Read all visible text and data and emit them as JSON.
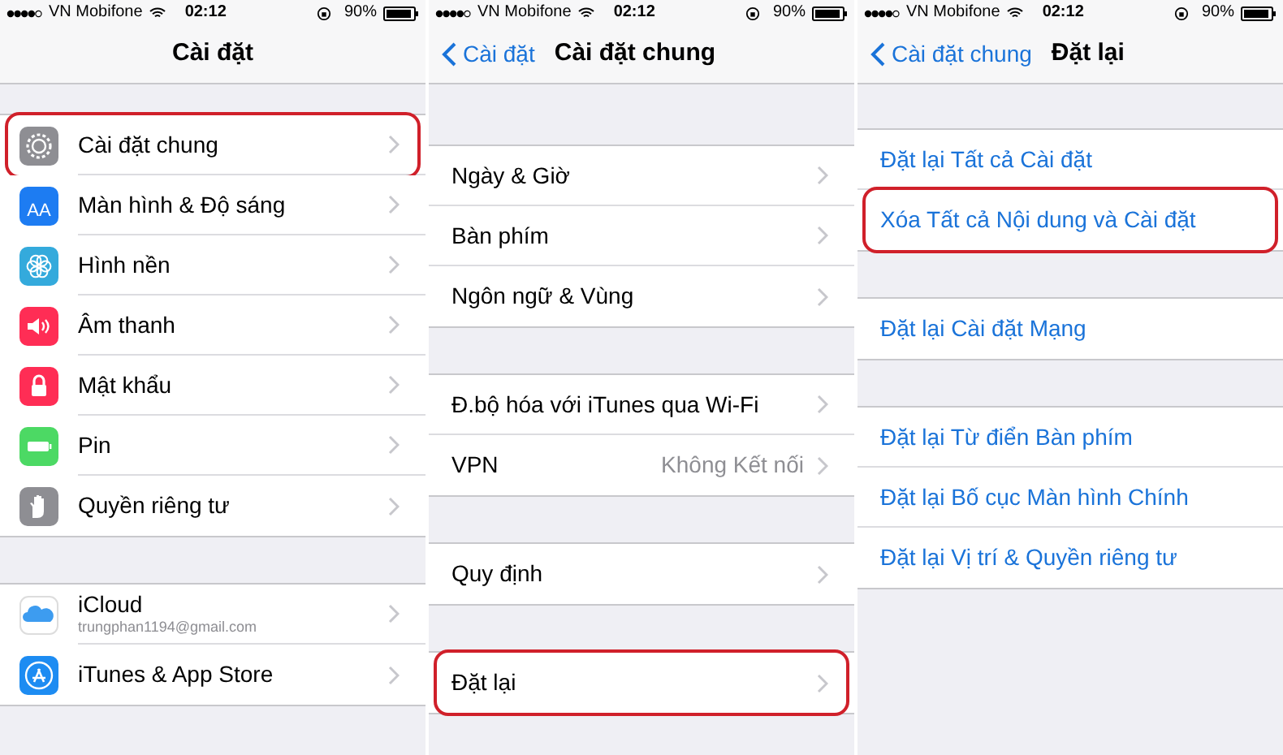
{
  "panels": [
    {
      "status": {
        "carrier": "VN Mobifone",
        "time": "02:12",
        "battery": "90%"
      },
      "nav": {
        "title": "Cài đặt"
      },
      "groups": [
        {
          "rows": [
            {
              "kind": "nav",
              "color": "#8e8e93",
              "label": "Cài đặt chung",
              "highlighted": true
            },
            {
              "kind": "nav",
              "icon_label": "AA",
              "color": "#1d7cf2",
              "label": "Màn hình & Độ sáng",
              "highlighted": false
            },
            {
              "kind": "nav",
              "color": "#34aadc",
              "label": "Hình nền",
              "highlighted": false
            },
            {
              "kind": "nav",
              "color": "#ff2d55",
              "label": "Âm thanh",
              "highlighted": false
            },
            {
              "kind": "nav",
              "color": "#ff2d55",
              "label": "Mật khẩu",
              "highlighted": false
            },
            {
              "kind": "nav",
              "color": "#4cd964",
              "label": "Pin",
              "highlighted": false
            },
            {
              "kind": "nav",
              "color": "#8e8e93",
              "label": "Quyền riêng tư",
              "highlighted": false
            }
          ]
        },
        {
          "rows": [
            {
              "kind": "nav",
              "color": "#3d9cf0",
              "label": "iCloud",
              "subtitle": "trungphan1194@gmail.com",
              "highlighted": false
            },
            {
              "kind": "nav",
              "color": "#1d8cf2",
              "label": "iTunes & App Store",
              "highlighted": false
            }
          ]
        }
      ]
    },
    {
      "status": {
        "carrier": "VN Mobifone",
        "time": "02:12",
        "battery": "90%"
      },
      "nav": {
        "back": "Cài đặt",
        "title": "Cài đặt chung"
      },
      "groups": [
        {
          "rows": [
            {
              "kind": "nav",
              "label": "Ngày & Giờ",
              "highlighted": false
            },
            {
              "kind": "nav",
              "label": "Bàn phím",
              "highlighted": false
            },
            {
              "kind": "nav",
              "label": "Ngôn ngữ & Vùng",
              "highlighted": false
            }
          ]
        },
        {
          "rows": [
            {
              "kind": "nav",
              "label": "Đ.bộ hóa với iTunes qua Wi-Fi",
              "highlighted": false
            },
            {
              "kind": "nav",
              "label": "VPN",
              "value": "Không Kết nối",
              "highlighted": false
            }
          ]
        },
        {
          "rows": [
            {
              "kind": "nav",
              "label": "Quy định",
              "highlighted": false
            }
          ]
        },
        {
          "rows": [
            {
              "kind": "nav",
              "label": "Đặt lại",
              "highlighted": true
            }
          ]
        }
      ]
    },
    {
      "status": {
        "carrier": "VN Mobifone",
        "time": "02:12",
        "battery": "90%"
      },
      "nav": {
        "back": "Cài đặt chung",
        "title": "Đặt lại"
      },
      "groups": [
        {
          "rows": [
            {
              "kind": "action",
              "label": "Đặt lại Tất cả Cài đặt",
              "highlighted": false
            },
            {
              "kind": "action",
              "label": "Xóa Tất cả Nội dung và Cài đặt",
              "highlighted": true
            }
          ]
        },
        {
          "rows": [
            {
              "kind": "action",
              "label": "Đặt lại Cài đặt Mạng",
              "highlighted": false
            }
          ]
        },
        {
          "rows": [
            {
              "kind": "action",
              "label": "Đặt lại Từ điển Bàn phím",
              "highlighted": false
            },
            {
              "kind": "action",
              "label": "Đặt lại Bố cục Màn hình Chính",
              "highlighted": false
            },
            {
              "kind": "action",
              "label": "Đặt lại Vị trí & Quyền riêng tư",
              "highlighted": false
            }
          ]
        }
      ]
    }
  ]
}
